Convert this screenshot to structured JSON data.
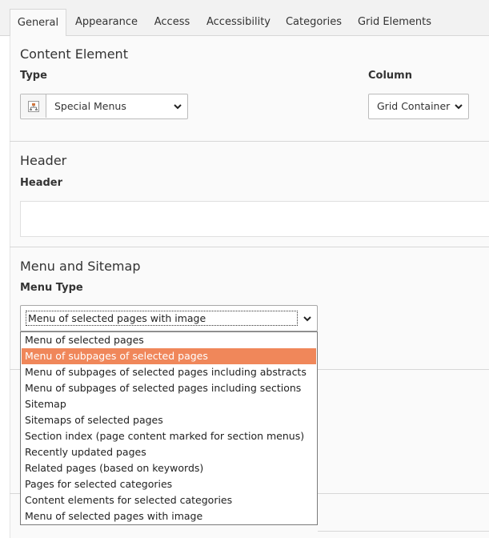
{
  "tabs": [
    {
      "label": "General",
      "active": true
    },
    {
      "label": "Appearance"
    },
    {
      "label": "Access"
    },
    {
      "label": "Accessibility"
    },
    {
      "label": "Categories"
    },
    {
      "label": "Grid Elements"
    }
  ],
  "content_element": {
    "title": "Content Element",
    "type_label": "Type",
    "type_value": "Special Menus",
    "column_label": "Column",
    "column_value": "Grid Container"
  },
  "header": {
    "title": "Header",
    "field_label": "Header",
    "field_value": ""
  },
  "menu": {
    "title": "Menu and Sitemap",
    "type_label": "Menu Type",
    "selected_value": "Menu of selected pages with image",
    "options": [
      "Menu of selected pages",
      "Menu of subpages of selected pages",
      "Menu of subpages of selected pages including abstracts",
      "Menu of subpages of selected pages including sections",
      "Sitemap",
      "Sitemaps of selected pages",
      "Section index (page content marked for section menus)",
      "Recently updated pages",
      "Related pages (based on keywords)",
      "Pages for selected categories",
      "Content elements for selected categories",
      "Menu of selected pages with image"
    ],
    "highlighted_option": "Menu of subpages of selected pages"
  },
  "colors": {
    "highlight": "#f0875a",
    "tabbar_bg": "#f2f2f2",
    "panel_bg": "#fafafa"
  }
}
